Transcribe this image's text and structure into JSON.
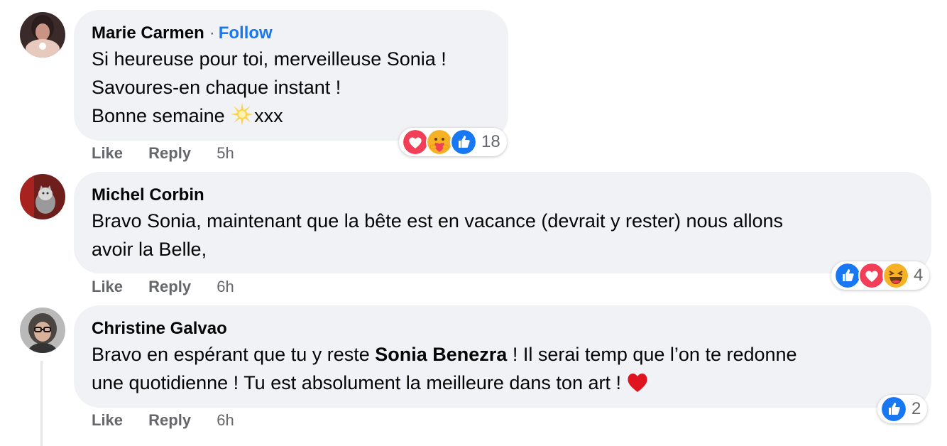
{
  "comments": [
    {
      "author": "Marie Carmen",
      "follow_dot": "·",
      "follow_label": "Follow",
      "lines": [
        "Si heureuse pour toi, merveilleuse Sonia !",
        "Savoures-en chaque instant !",
        "Bonne semaine ",
        "xxx"
      ],
      "actions": {
        "like": "Like",
        "reply": "Reply",
        "time": "5h"
      },
      "reactions": {
        "icons": [
          "love-icon",
          "care-icon",
          "like-icon"
        ],
        "count": "18"
      }
    },
    {
      "author": "Michel Corbin",
      "lines": [
        "Bravo Sonia, maintenant que la bête est en vacance (devrait y rester) nous allons",
        "avoir la Belle,"
      ],
      "actions": {
        "like": "Like",
        "reply": "Reply",
        "time": "6h"
      },
      "reactions": {
        "icons": [
          "like-icon",
          "love-icon",
          "haha-icon"
        ],
        "count": "4"
      }
    },
    {
      "author": "Christine Galvao",
      "text_before": "Bravo en espérant que tu y reste ",
      "mention": "Sonia Benezra",
      "text_after": " ! Il serai temp que l’on te redonne",
      "line2": "une quotidienne ! Tu est absolument la meilleure dans ton art ! ",
      "actions": {
        "like": "Like",
        "reply": "Reply",
        "time": "6h"
      },
      "reactions": {
        "icons": [
          "like-icon"
        ],
        "count": "2"
      }
    }
  ],
  "colors": {
    "bubble": "#f0f2f5",
    "link": "#1877f2",
    "muted": "#65676b",
    "like": "#1877f2",
    "love": "#f33e58",
    "haha": "#f7b125"
  }
}
